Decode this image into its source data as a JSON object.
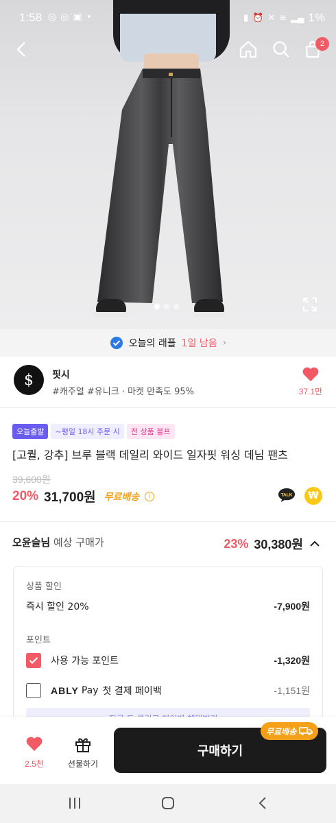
{
  "status_bar": {
    "time": "1:58",
    "battery": "1%",
    "left_icons": [
      "instagram-icon",
      "instagram-icon",
      "gallery-icon",
      "dot-icon"
    ],
    "right_icons": [
      "battery-saver-icon",
      "alarm-icon",
      "mute-icon",
      "wifi-icon",
      "signal-icon"
    ]
  },
  "top_bar": {
    "back_icon": "back-arrow-icon",
    "home_icon": "home-icon",
    "search_icon": "search-icon",
    "cart_icon": "shopping-bag-icon",
    "cart_count": "2"
  },
  "gallery": {
    "pages": 3,
    "active_page": 1
  },
  "raffle": {
    "prefix": "오늘의 래플",
    "highlight": "1일 남음",
    "chevron": "›"
  },
  "shop": {
    "logo_text": "$",
    "name": "핏시",
    "tags": "#캐주얼 #유니크 · 마켓 만족도 95%",
    "likes": "37.1만"
  },
  "product": {
    "badges": [
      "오늘출발",
      "~평일 18시 주문 시",
      "전 상품 블프"
    ],
    "title": "[고퀄, 강추] 브루 블랙 데일리 와이드 일자핏 워싱 데님 팬츠",
    "original_price": "39,600원",
    "discount_rate": "20%",
    "price": "31,700원",
    "shipping": "무료배송",
    "info_icon": "i",
    "talk_label": "TALK",
    "won_symbol": "₩"
  },
  "estimate": {
    "user": "오윤슬님",
    "label": "예상 구매가",
    "rate": "23%",
    "price": "30,380원"
  },
  "breakdown": {
    "discount_section": "상품 할인",
    "instant_label": "즉시 할인 20%",
    "instant_amount": "-7,900원",
    "point_section": "포인트",
    "points_label": "사용 가능 포인트",
    "points_amount": "-1,320원",
    "points_checked": true,
    "ably_brand": "ABLY",
    "ably_pay": "Pay",
    "ably_label": "첫 결제 페이백",
    "ably_amount": "-1,151원",
    "ably_checked": false,
    "link_text": "지금 도 클릭고 페이백 혜택받기 →"
  },
  "bottom_bar": {
    "like_count": "2.5천",
    "gift_label": "선물하기",
    "buy_label": "구매하기",
    "ship_tag": "무료배송"
  },
  "colors": {
    "accent": "#f25a65",
    "shipping": "#f4a019",
    "badge_purple": "#6a5cf0",
    "buy_button": "#1b1b1b"
  }
}
